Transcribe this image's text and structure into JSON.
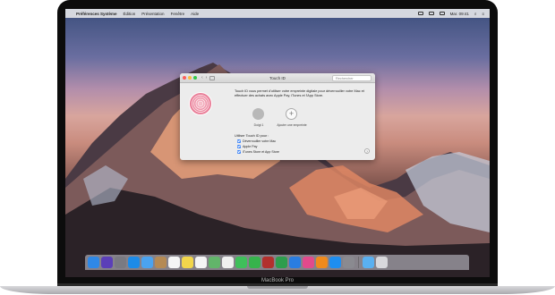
{
  "menubar": {
    "app": "Préférences Système",
    "items": [
      "Édition",
      "Présentation",
      "Fenêtre",
      "Aide"
    ],
    "time": "Mar. 09:41"
  },
  "window": {
    "title": "Touch ID",
    "search_placeholder": "Rechercher",
    "description": "Touch ID vous permet d'utiliser votre empreinte digitale pour déverrouiller votre Mac et effectuer des achats avec Apple Pay, iTunes et l'App Store.",
    "finger_label": "Doigt 1",
    "add_label": "Ajouter une empreinte",
    "use_label": "Utiliser Touch ID pour :",
    "options": [
      "Déverrouiller votre Mac",
      "Apple Pay",
      "iTunes Store et App Store"
    ],
    "help": "?"
  },
  "device": {
    "brand": "MacBook Pro"
  },
  "dock": {
    "icons": [
      {
        "name": "finder-icon",
        "color": "#2f88e6"
      },
      {
        "name": "siri-icon",
        "color": "#5b3fb8"
      },
      {
        "name": "launchpad-icon",
        "color": "#7a7a82"
      },
      {
        "name": "safari-icon",
        "color": "#1d8be8"
      },
      {
        "name": "mail-icon",
        "color": "#4aa3f0"
      },
      {
        "name": "contacts-icon",
        "color": "#b58a54"
      },
      {
        "name": "calendar-icon",
        "color": "#f5f5f5"
      },
      {
        "name": "notes-icon",
        "color": "#f2d64b"
      },
      {
        "name": "reminders-icon",
        "color": "#f5f5f5"
      },
      {
        "name": "maps-icon",
        "color": "#62b56a"
      },
      {
        "name": "photos-icon",
        "color": "#f0f0f0"
      },
      {
        "name": "messages-icon",
        "color": "#3fbf5a"
      },
      {
        "name": "facetime-icon",
        "color": "#36b34c"
      },
      {
        "name": "photo-booth-icon",
        "color": "#b2302d"
      },
      {
        "name": "numbers-icon",
        "color": "#2e9d4d"
      },
      {
        "name": "keynote-icon",
        "color": "#2a7de0"
      },
      {
        "name": "itunes-icon",
        "color": "#e24a8c"
      },
      {
        "name": "ibooks-icon",
        "color": "#f08a1c"
      },
      {
        "name": "app-store-icon",
        "color": "#1e8ef0"
      },
      {
        "name": "system-preferences-icon",
        "color": "#8a8a90"
      },
      {
        "name": "downloads-folder-icon",
        "color": "#5ab0f0"
      },
      {
        "name": "trash-icon",
        "color": "#d8d8dc"
      }
    ]
  }
}
